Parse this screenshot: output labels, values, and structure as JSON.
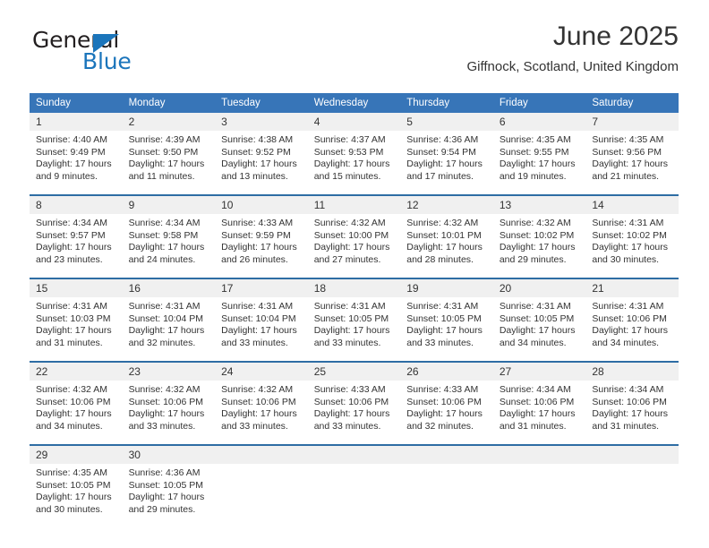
{
  "brand": {
    "name_top": "General",
    "name_bottom": "Blue",
    "accent_color": "#1b75bb"
  },
  "header": {
    "title": "June 2025",
    "location": "Giffnock, Scotland, United Kingdom"
  },
  "theme": {
    "header_bg": "#3775b8",
    "header_text": "#ffffff",
    "daynum_bg": "#f0f0f0",
    "rule_color": "#2e6da4"
  },
  "columns": [
    "Sunday",
    "Monday",
    "Tuesday",
    "Wednesday",
    "Thursday",
    "Friday",
    "Saturday"
  ],
  "weeks": [
    [
      {
        "day": "1",
        "sunrise": "Sunrise: 4:40 AM",
        "sunset": "Sunset: 9:49 PM",
        "daylight_1": "Daylight: 17 hours",
        "daylight_2": "and 9 minutes."
      },
      {
        "day": "2",
        "sunrise": "Sunrise: 4:39 AM",
        "sunset": "Sunset: 9:50 PM",
        "daylight_1": "Daylight: 17 hours",
        "daylight_2": "and 11 minutes."
      },
      {
        "day": "3",
        "sunrise": "Sunrise: 4:38 AM",
        "sunset": "Sunset: 9:52 PM",
        "daylight_1": "Daylight: 17 hours",
        "daylight_2": "and 13 minutes."
      },
      {
        "day": "4",
        "sunrise": "Sunrise: 4:37 AM",
        "sunset": "Sunset: 9:53 PM",
        "daylight_1": "Daylight: 17 hours",
        "daylight_2": "and 15 minutes."
      },
      {
        "day": "5",
        "sunrise": "Sunrise: 4:36 AM",
        "sunset": "Sunset: 9:54 PM",
        "daylight_1": "Daylight: 17 hours",
        "daylight_2": "and 17 minutes."
      },
      {
        "day": "6",
        "sunrise": "Sunrise: 4:35 AM",
        "sunset": "Sunset: 9:55 PM",
        "daylight_1": "Daylight: 17 hours",
        "daylight_2": "and 19 minutes."
      },
      {
        "day": "7",
        "sunrise": "Sunrise: 4:35 AM",
        "sunset": "Sunset: 9:56 PM",
        "daylight_1": "Daylight: 17 hours",
        "daylight_2": "and 21 minutes."
      }
    ],
    [
      {
        "day": "8",
        "sunrise": "Sunrise: 4:34 AM",
        "sunset": "Sunset: 9:57 PM",
        "daylight_1": "Daylight: 17 hours",
        "daylight_2": "and 23 minutes."
      },
      {
        "day": "9",
        "sunrise": "Sunrise: 4:34 AM",
        "sunset": "Sunset: 9:58 PM",
        "daylight_1": "Daylight: 17 hours",
        "daylight_2": "and 24 minutes."
      },
      {
        "day": "10",
        "sunrise": "Sunrise: 4:33 AM",
        "sunset": "Sunset: 9:59 PM",
        "daylight_1": "Daylight: 17 hours",
        "daylight_2": "and 26 minutes."
      },
      {
        "day": "11",
        "sunrise": "Sunrise: 4:32 AM",
        "sunset": "Sunset: 10:00 PM",
        "daylight_1": "Daylight: 17 hours",
        "daylight_2": "and 27 minutes."
      },
      {
        "day": "12",
        "sunrise": "Sunrise: 4:32 AM",
        "sunset": "Sunset: 10:01 PM",
        "daylight_1": "Daylight: 17 hours",
        "daylight_2": "and 28 minutes."
      },
      {
        "day": "13",
        "sunrise": "Sunrise: 4:32 AM",
        "sunset": "Sunset: 10:02 PM",
        "daylight_1": "Daylight: 17 hours",
        "daylight_2": "and 29 minutes."
      },
      {
        "day": "14",
        "sunrise": "Sunrise: 4:31 AM",
        "sunset": "Sunset: 10:02 PM",
        "daylight_1": "Daylight: 17 hours",
        "daylight_2": "and 30 minutes."
      }
    ],
    [
      {
        "day": "15",
        "sunrise": "Sunrise: 4:31 AM",
        "sunset": "Sunset: 10:03 PM",
        "daylight_1": "Daylight: 17 hours",
        "daylight_2": "and 31 minutes."
      },
      {
        "day": "16",
        "sunrise": "Sunrise: 4:31 AM",
        "sunset": "Sunset: 10:04 PM",
        "daylight_1": "Daylight: 17 hours",
        "daylight_2": "and 32 minutes."
      },
      {
        "day": "17",
        "sunrise": "Sunrise: 4:31 AM",
        "sunset": "Sunset: 10:04 PM",
        "daylight_1": "Daylight: 17 hours",
        "daylight_2": "and 33 minutes."
      },
      {
        "day": "18",
        "sunrise": "Sunrise: 4:31 AM",
        "sunset": "Sunset: 10:05 PM",
        "daylight_1": "Daylight: 17 hours",
        "daylight_2": "and 33 minutes."
      },
      {
        "day": "19",
        "sunrise": "Sunrise: 4:31 AM",
        "sunset": "Sunset: 10:05 PM",
        "daylight_1": "Daylight: 17 hours",
        "daylight_2": "and 33 minutes."
      },
      {
        "day": "20",
        "sunrise": "Sunrise: 4:31 AM",
        "sunset": "Sunset: 10:05 PM",
        "daylight_1": "Daylight: 17 hours",
        "daylight_2": "and 34 minutes."
      },
      {
        "day": "21",
        "sunrise": "Sunrise: 4:31 AM",
        "sunset": "Sunset: 10:06 PM",
        "daylight_1": "Daylight: 17 hours",
        "daylight_2": "and 34 minutes."
      }
    ],
    [
      {
        "day": "22",
        "sunrise": "Sunrise: 4:32 AM",
        "sunset": "Sunset: 10:06 PM",
        "daylight_1": "Daylight: 17 hours",
        "daylight_2": "and 34 minutes."
      },
      {
        "day": "23",
        "sunrise": "Sunrise: 4:32 AM",
        "sunset": "Sunset: 10:06 PM",
        "daylight_1": "Daylight: 17 hours",
        "daylight_2": "and 33 minutes."
      },
      {
        "day": "24",
        "sunrise": "Sunrise: 4:32 AM",
        "sunset": "Sunset: 10:06 PM",
        "daylight_1": "Daylight: 17 hours",
        "daylight_2": "and 33 minutes."
      },
      {
        "day": "25",
        "sunrise": "Sunrise: 4:33 AM",
        "sunset": "Sunset: 10:06 PM",
        "daylight_1": "Daylight: 17 hours",
        "daylight_2": "and 33 minutes."
      },
      {
        "day": "26",
        "sunrise": "Sunrise: 4:33 AM",
        "sunset": "Sunset: 10:06 PM",
        "daylight_1": "Daylight: 17 hours",
        "daylight_2": "and 32 minutes."
      },
      {
        "day": "27",
        "sunrise": "Sunrise: 4:34 AM",
        "sunset": "Sunset: 10:06 PM",
        "daylight_1": "Daylight: 17 hours",
        "daylight_2": "and 31 minutes."
      },
      {
        "day": "28",
        "sunrise": "Sunrise: 4:34 AM",
        "sunset": "Sunset: 10:06 PM",
        "daylight_1": "Daylight: 17 hours",
        "daylight_2": "and 31 minutes."
      }
    ],
    [
      {
        "day": "29",
        "sunrise": "Sunrise: 4:35 AM",
        "sunset": "Sunset: 10:05 PM",
        "daylight_1": "Daylight: 17 hours",
        "daylight_2": "and 30 minutes."
      },
      {
        "day": "30",
        "sunrise": "Sunrise: 4:36 AM",
        "sunset": "Sunset: 10:05 PM",
        "daylight_1": "Daylight: 17 hours",
        "daylight_2": "and 29 minutes."
      },
      {
        "day": "",
        "sunrise": "",
        "sunset": "",
        "daylight_1": "",
        "daylight_2": ""
      },
      {
        "day": "",
        "sunrise": "",
        "sunset": "",
        "daylight_1": "",
        "daylight_2": ""
      },
      {
        "day": "",
        "sunrise": "",
        "sunset": "",
        "daylight_1": "",
        "daylight_2": ""
      },
      {
        "day": "",
        "sunrise": "",
        "sunset": "",
        "daylight_1": "",
        "daylight_2": ""
      },
      {
        "day": "",
        "sunrise": "",
        "sunset": "",
        "daylight_1": "",
        "daylight_2": ""
      }
    ]
  ]
}
